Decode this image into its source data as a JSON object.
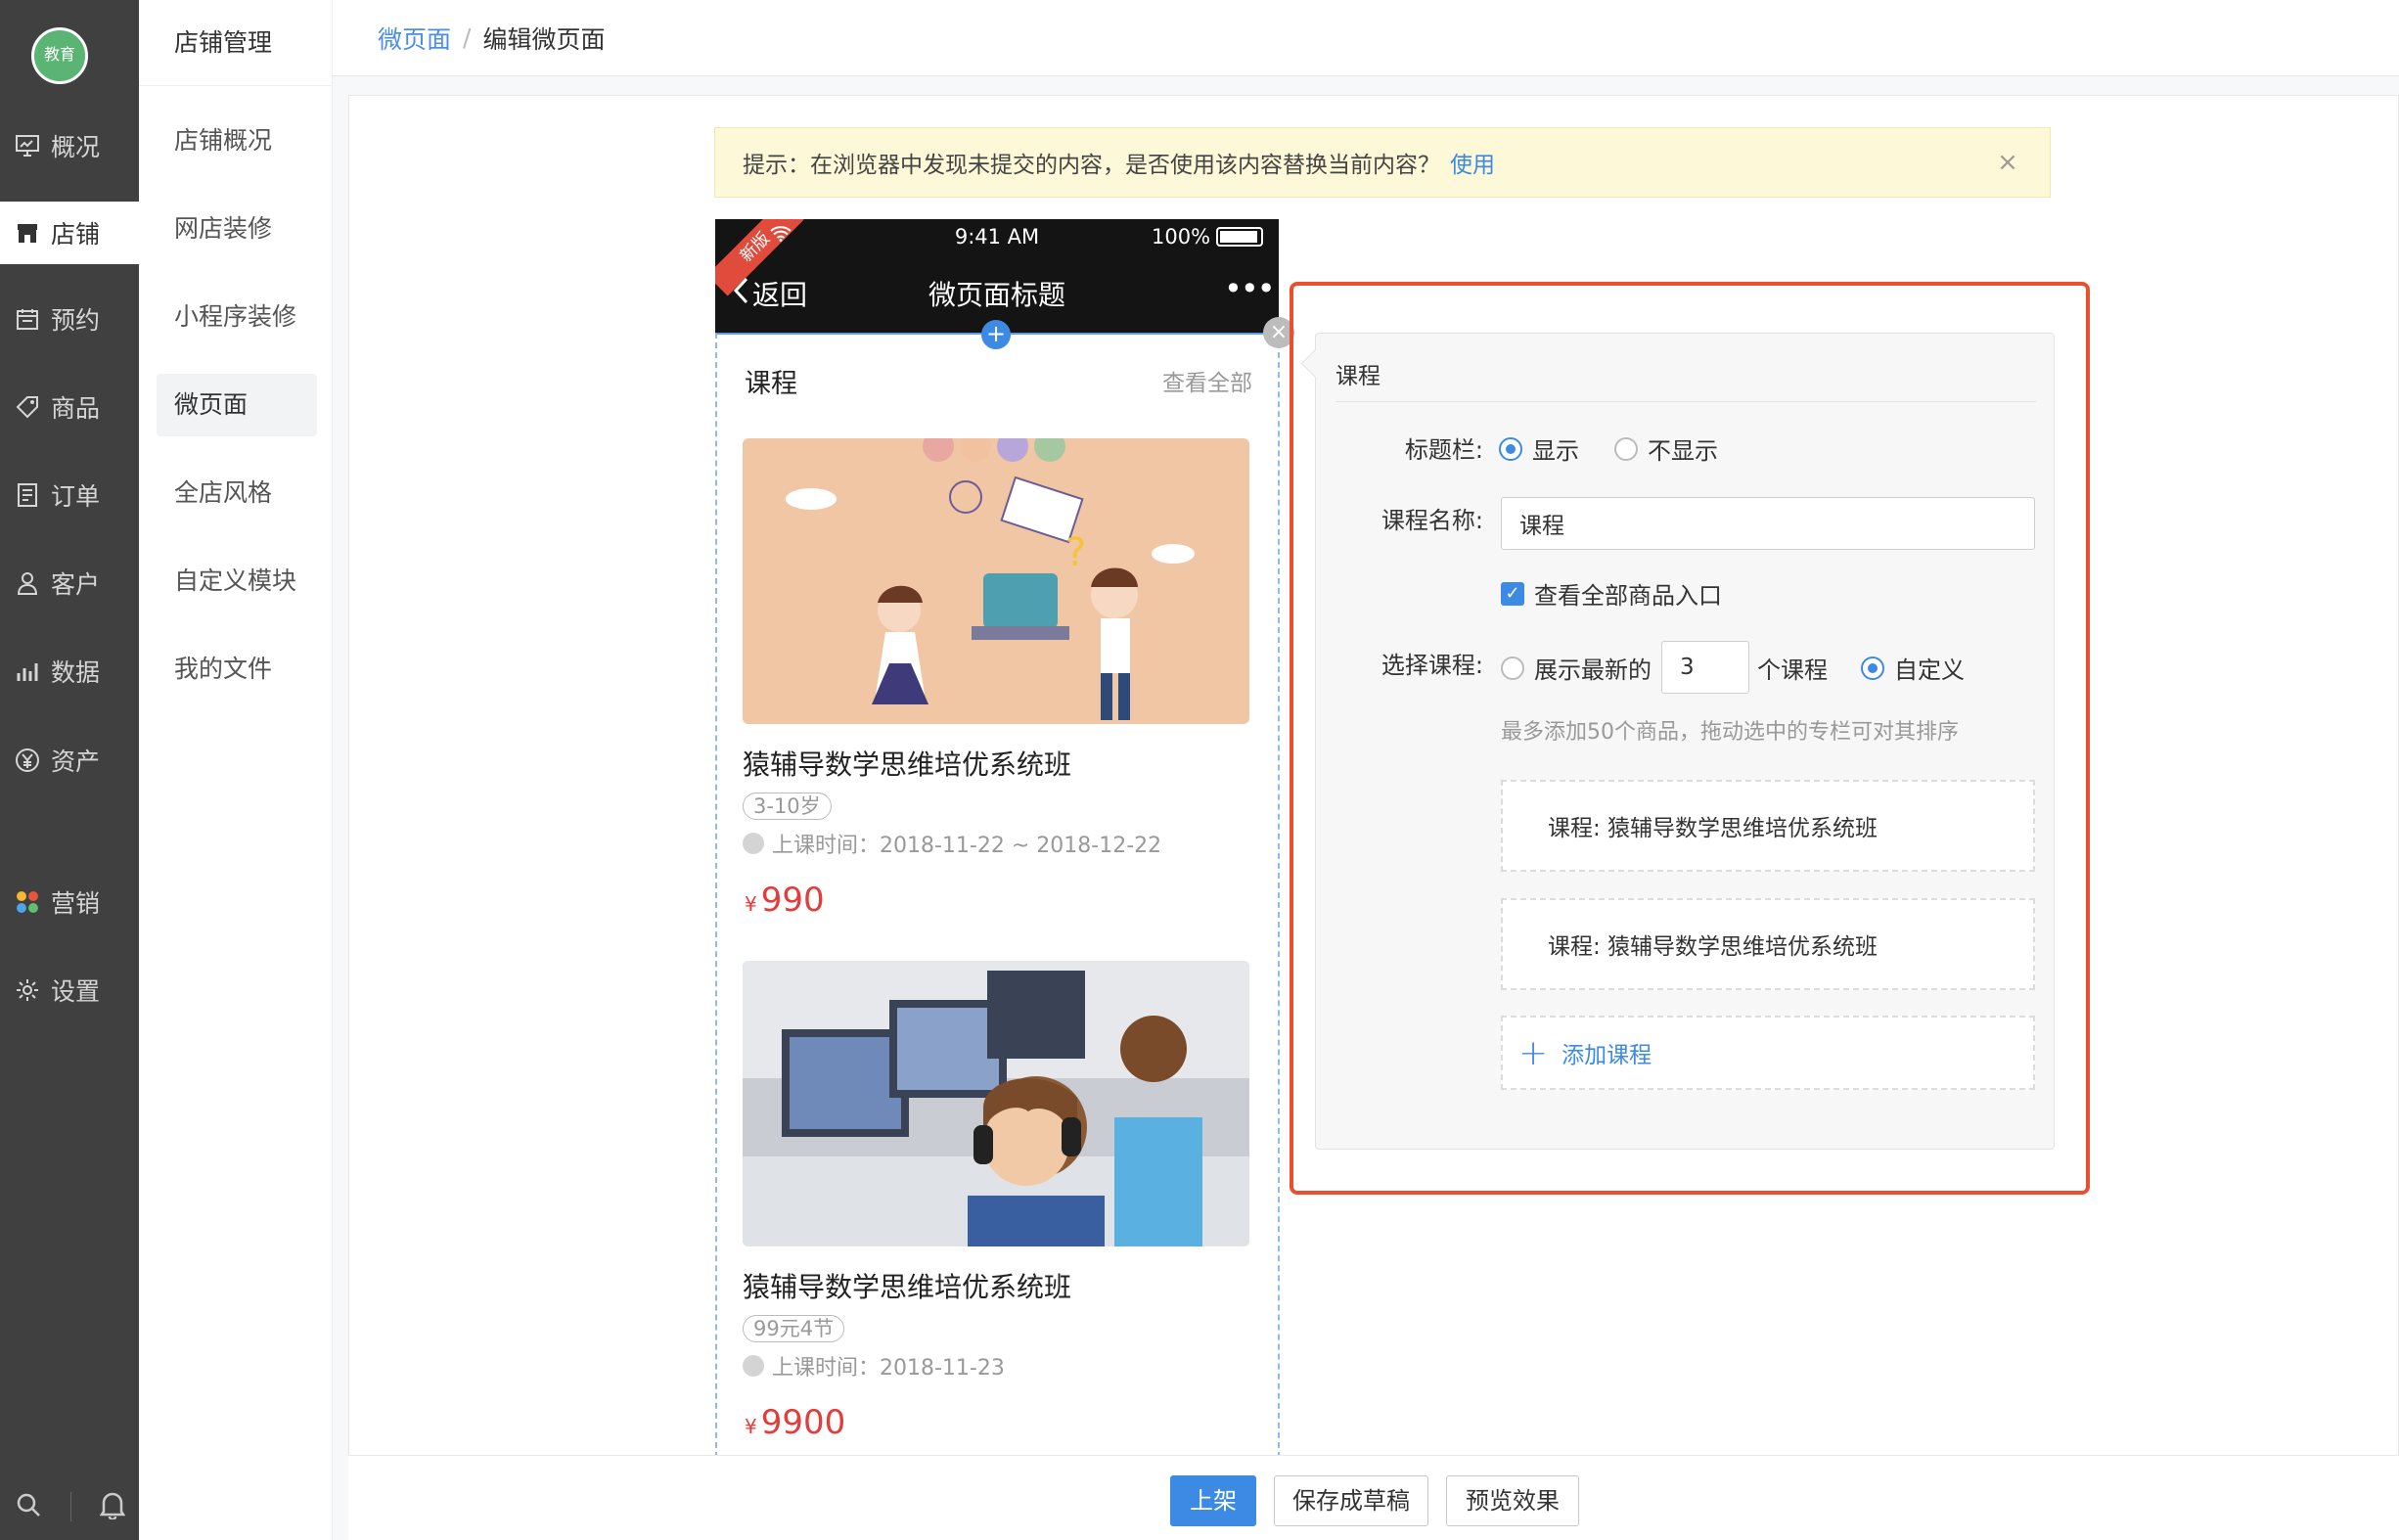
{
  "nav_primary": {
    "logo_text": "教育",
    "items": [
      {
        "label": "概况",
        "icon": "monitor-icon"
      },
      {
        "label": "店铺",
        "icon": "store-icon"
      },
      {
        "label": "预约",
        "icon": "calendar-icon"
      },
      {
        "label": "商品",
        "icon": "tag-icon"
      },
      {
        "label": "订单",
        "icon": "order-icon"
      },
      {
        "label": "客户",
        "icon": "user-icon"
      },
      {
        "label": "数据",
        "icon": "chart-icon"
      },
      {
        "label": "资产",
        "icon": "yen-icon"
      },
      {
        "label": "营销",
        "icon": "marketing-icon"
      },
      {
        "label": "设置",
        "icon": "gear-icon"
      }
    ],
    "active": "店铺"
  },
  "nav_secondary": {
    "title": "店铺管理",
    "items": [
      "店铺概况",
      "网店装修",
      "小程序装修",
      "微页面",
      "全店风格",
      "自定义模块",
      "我的文件"
    ],
    "active": "微页面"
  },
  "breadcrumb": {
    "parent": "微页面",
    "sep": "/",
    "current": "编辑微页面"
  },
  "tip": {
    "text": "提示：在浏览器中发现未提交的内容，是否使用该内容替换当前内容？",
    "action": "使用",
    "close": "×"
  },
  "phone": {
    "ribbon": "新版",
    "time": "9:41 AM",
    "battery": "100%",
    "back": "返回",
    "title": "微页面标题",
    "more": "•••",
    "add": "+",
    "remove": "×",
    "module_title": "课程",
    "view_all": "查看全部",
    "courses": [
      {
        "name": "猿辅导数学思维培优系统班",
        "tag": "3-10岁",
        "time": "上课时间：2018-11-22 ~ 2018-12-22",
        "currency": "¥",
        "price": "990"
      },
      {
        "name": "猿辅导数学思维培优系统班",
        "tag": "99元4节",
        "time": "上课时间：2018-11-23",
        "currency": "¥",
        "price": "9900"
      }
    ]
  },
  "editor": {
    "heading": "课程",
    "title_bar_label": "标题栏:",
    "show": "显示",
    "hide": "不显示",
    "course_name_label": "课程名称:",
    "course_name_value": "课程",
    "check_label": "查看全部商品入口",
    "check_mark": "✓",
    "select_label": "选择课程:",
    "latest_prefix": "展示最新的",
    "latest_count": "3",
    "latest_suffix": "个课程",
    "custom": "自定义",
    "hint": "最多添加50个商品，拖动选中的专栏可对其排序",
    "selected": [
      "课程:  猿辅导数学思维培优系统班",
      "课程:  猿辅导数学思维培优系统班"
    ],
    "add_plus": "+",
    "add_label": "添加课程"
  },
  "footer": {
    "publish": "上架",
    "save_draft": "保存成草稿",
    "preview": "预览效果"
  },
  "colors": {
    "accent": "#3d8ae5",
    "highlight": "#e8502e",
    "price": "#e33c3c",
    "sidebar": "#404040"
  }
}
